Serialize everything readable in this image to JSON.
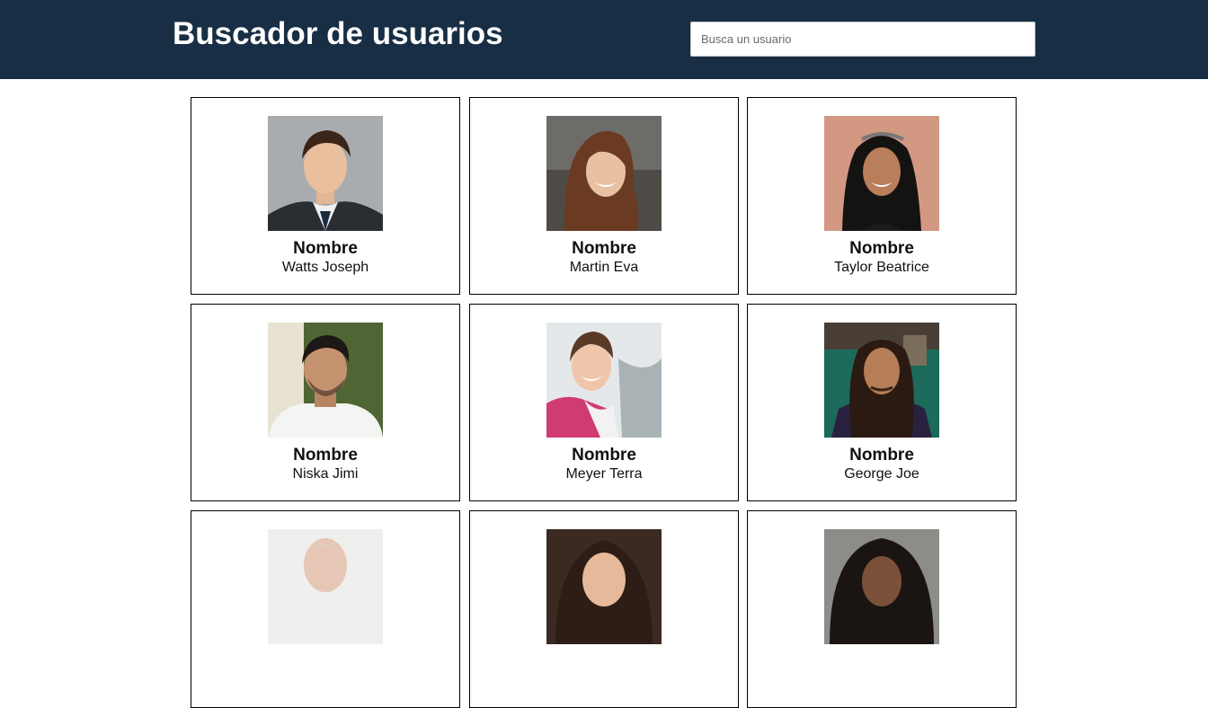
{
  "header": {
    "title": "Buscador de usuarios",
    "search_placeholder": "Busca un usuario",
    "background": "#182e44"
  },
  "users": [
    {
      "label": "Nombre",
      "name": "Watts Joseph",
      "photo_icon": "user-photo-icon"
    },
    {
      "label": "Nombre",
      "name": "Martin Eva",
      "photo_icon": "user-photo-icon"
    },
    {
      "label": "Nombre",
      "name": "Taylor Beatrice",
      "photo_icon": "user-photo-icon"
    },
    {
      "label": "Nombre",
      "name": "Niska Jimi",
      "photo_icon": "user-photo-icon"
    },
    {
      "label": "Nombre",
      "name": "Meyer Terra",
      "photo_icon": "user-photo-icon"
    },
    {
      "label": "Nombre",
      "name": "George Joe",
      "photo_icon": "user-photo-icon"
    },
    {
      "label": "",
      "name": "",
      "photo_icon": "user-photo-icon"
    },
    {
      "label": "",
      "name": "",
      "photo_icon": "user-photo-icon"
    },
    {
      "label": "",
      "name": "",
      "photo_icon": "user-photo-icon"
    }
  ]
}
